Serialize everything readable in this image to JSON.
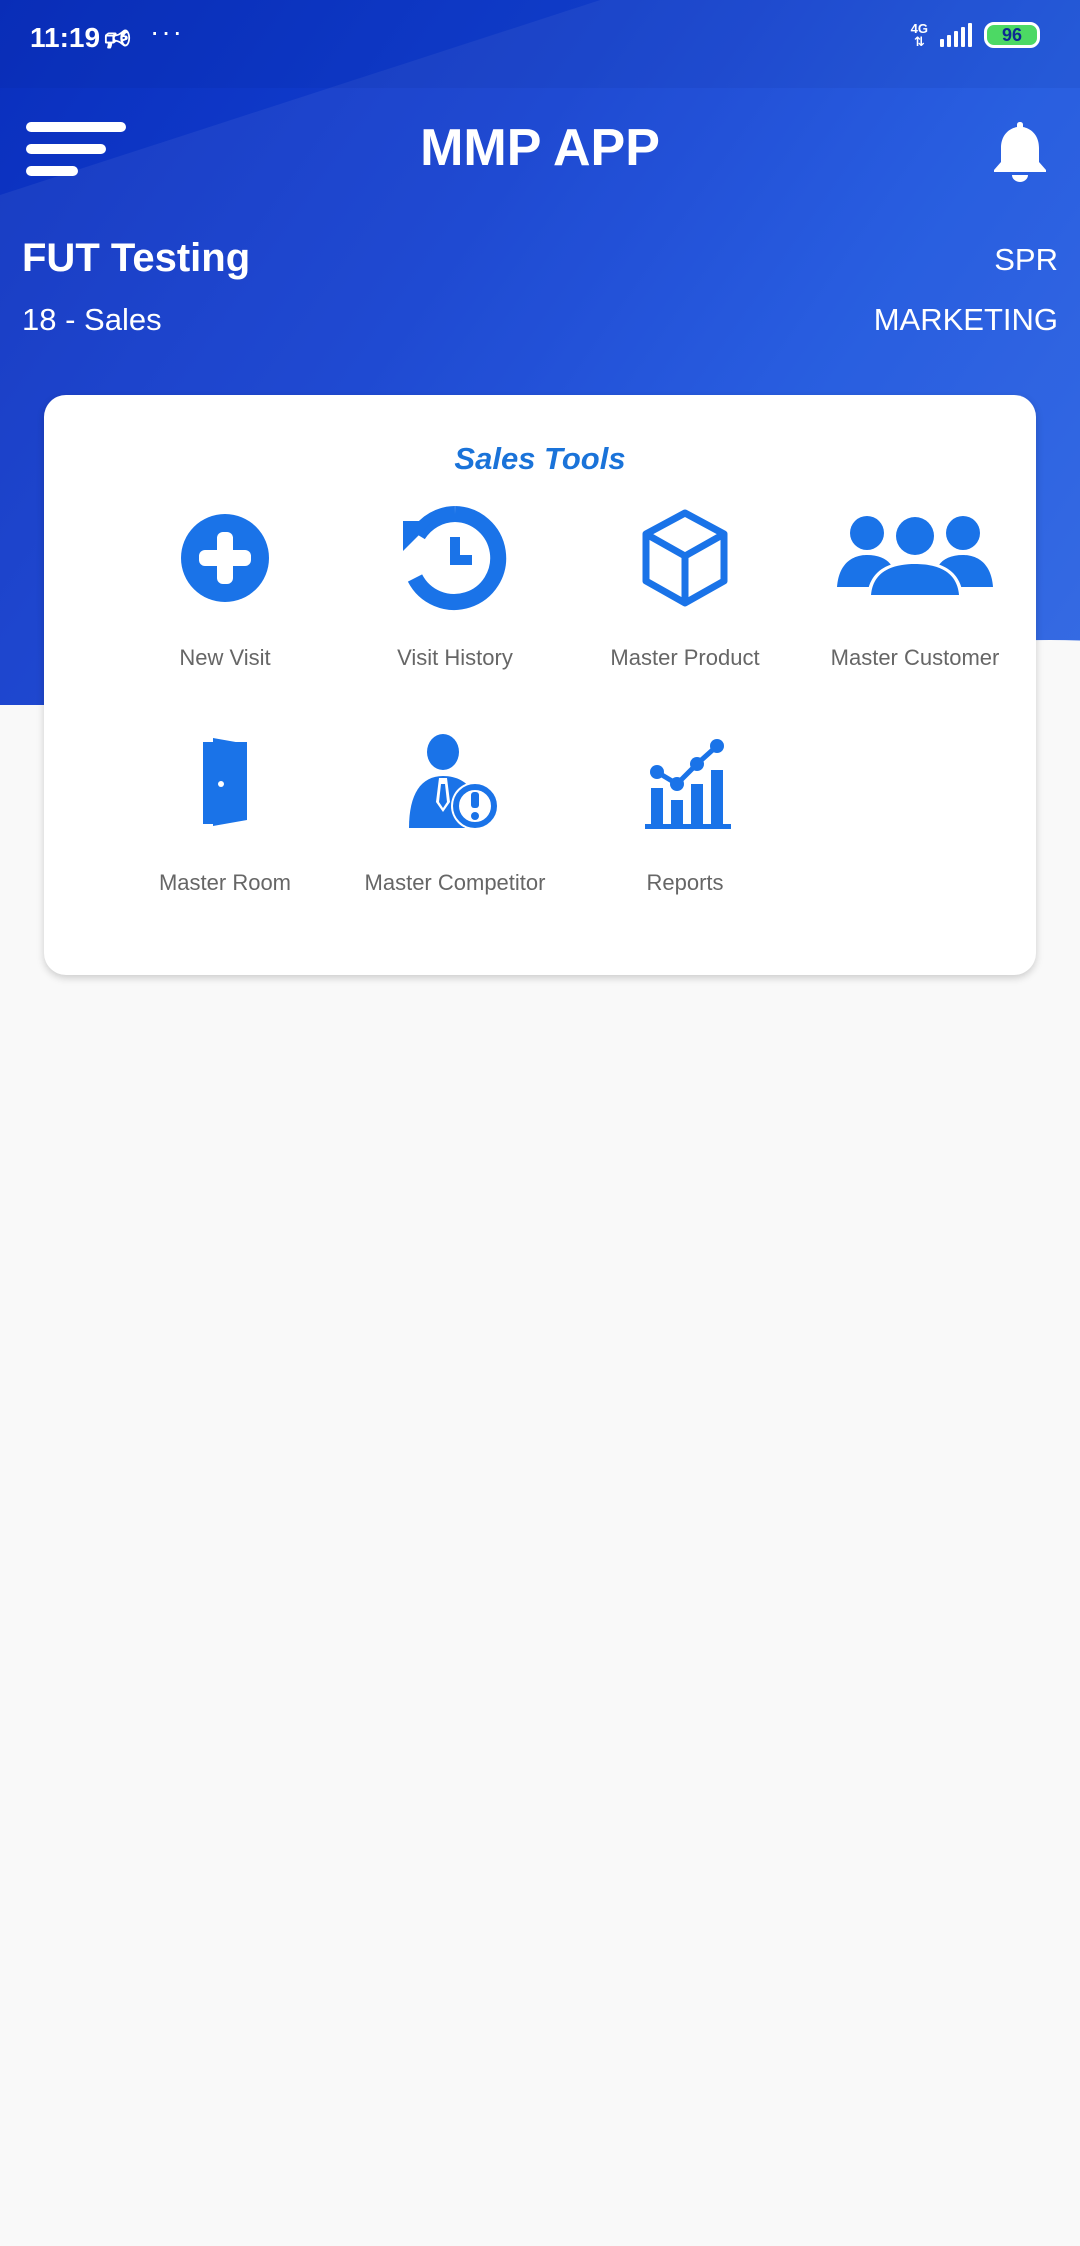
{
  "status_bar": {
    "time": "11:19",
    "extra_icon": "🕫",
    "dots": "···",
    "network": "4G",
    "battery": "96"
  },
  "header": {
    "title": "MMP APP",
    "menu_icon": "hamburger-menu-icon",
    "notification_icon": "bell-icon"
  },
  "user": {
    "name": "FUT Testing",
    "role": "18 - Sales",
    "code": "SPR",
    "department": "MARKETING"
  },
  "sales_tools": {
    "title": "Sales Tools",
    "accent_color": "#1a73d9",
    "items": [
      {
        "label": "New Visit",
        "icon": "plus-circle-icon"
      },
      {
        "label": "Visit History",
        "icon": "history-icon"
      },
      {
        "label": "Master Product",
        "icon": "cube-icon"
      },
      {
        "label": "Master Customer",
        "icon": "users-icon"
      },
      {
        "label": "Master Room",
        "icon": "door-icon"
      },
      {
        "label": "Master Competitor",
        "icon": "competitor-icon"
      },
      {
        "label": "Reports",
        "icon": "chart-icon"
      }
    ]
  }
}
